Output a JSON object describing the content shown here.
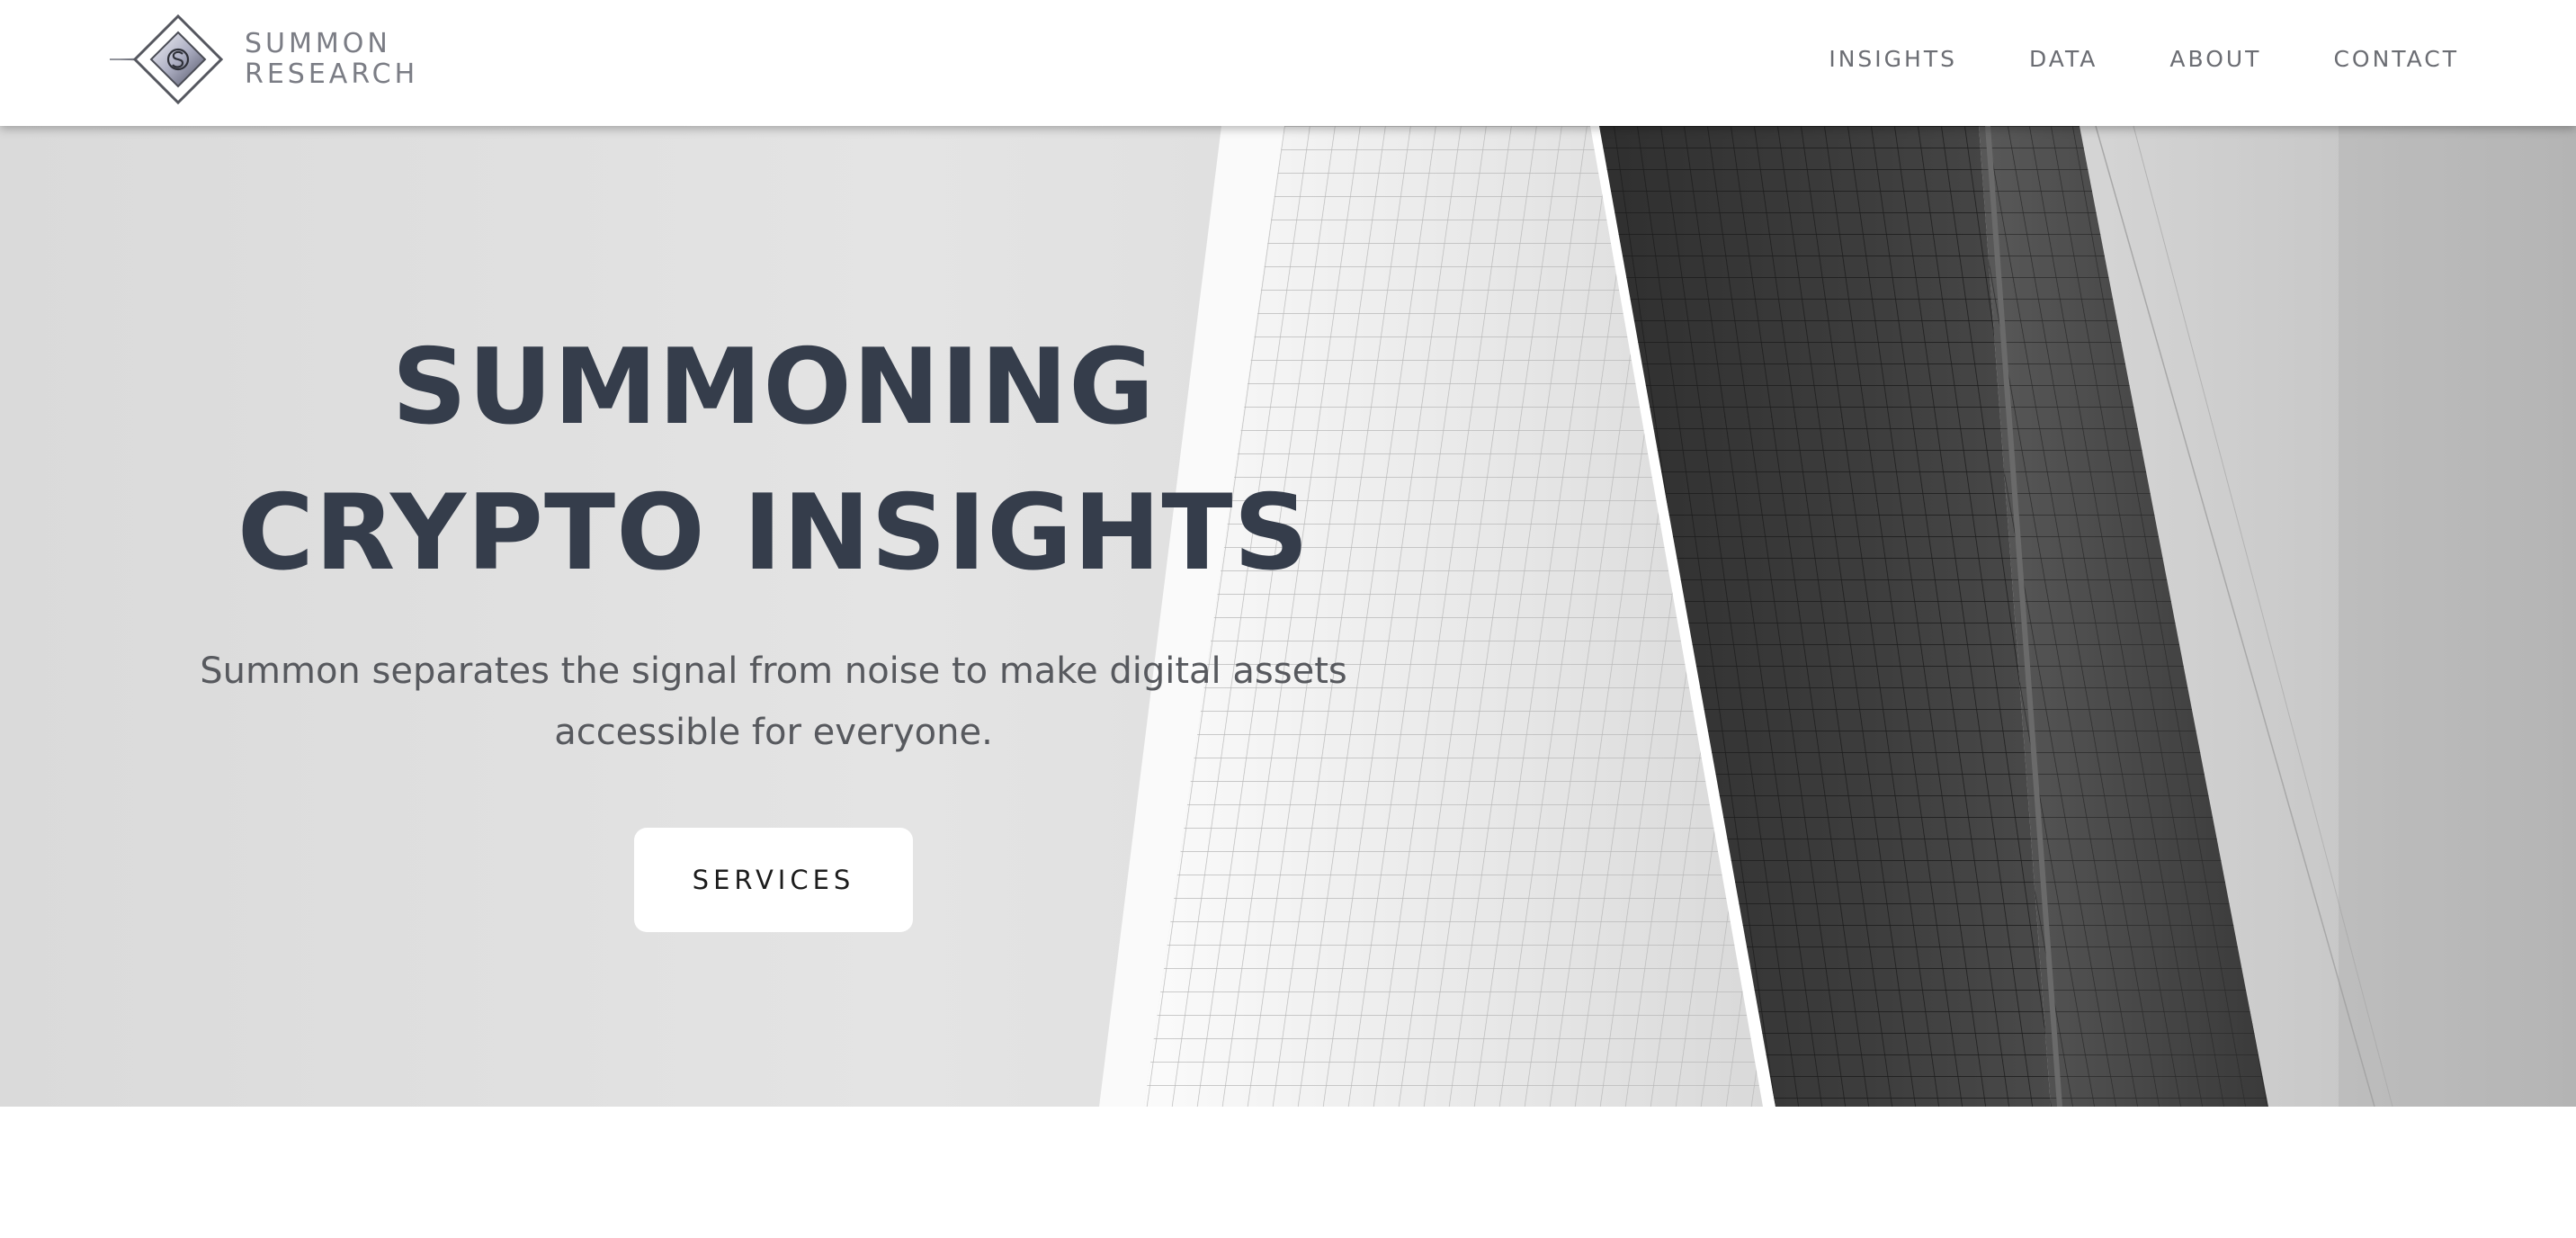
{
  "brand": {
    "name_line1": "SUMMON",
    "name_line2": "RESEARCH",
    "logo_icon": "summon-s-diamond-icon"
  },
  "nav": {
    "items": [
      {
        "label": "INSIGHTS"
      },
      {
        "label": "DATA"
      },
      {
        "label": "ABOUT"
      },
      {
        "label": "CONTACT"
      }
    ]
  },
  "hero": {
    "title": "SUMMONING CRYPTO INSIGHTS",
    "subtitle": "Summon separates the signal from noise to make digital assets accessible for everyone.",
    "cta_label": "SERVICES",
    "background": "black-and-white skyscraper photo"
  },
  "colors": {
    "title": "#353d4b",
    "subtitle": "#57595e",
    "nav_text": "#6b6d73",
    "brand_text": "#7b7d85",
    "button_bg": "#ffffff"
  }
}
